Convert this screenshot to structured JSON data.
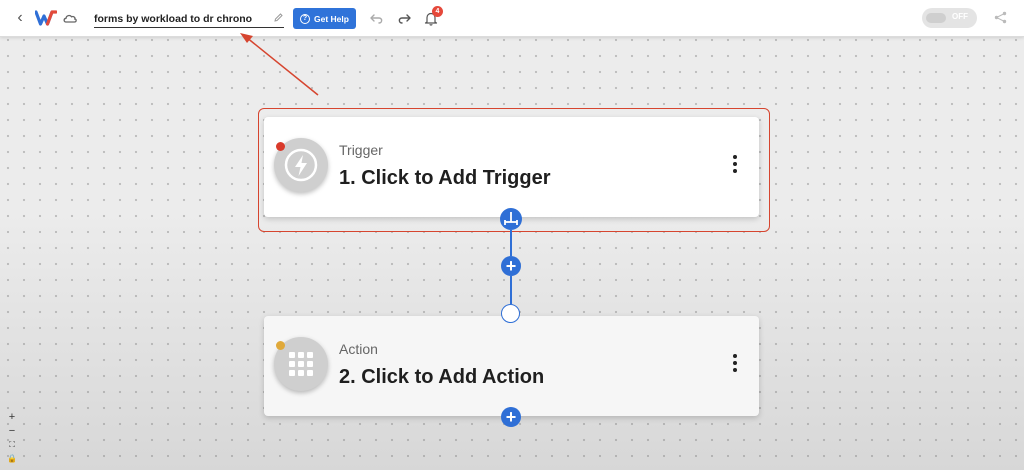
{
  "topbar": {
    "back_label": "‹",
    "logo_icon": "workload-logo-icon",
    "workflow_name": "forms by workload to dr chrono",
    "help_button_label": "Get Help",
    "help_icon_glyph": "?",
    "notification_count": "4",
    "toggle_label": "OFF"
  },
  "canvas": {
    "trigger": {
      "type_label": "Trigger",
      "title": "1. Click to Add Trigger",
      "status_color": "#d93a2b"
    },
    "action": {
      "type_label": "Action",
      "title": "2. Click to Add Action",
      "status_color": "#e0a93a"
    },
    "add_glyph": "+"
  },
  "zoom": {
    "zoom_in": "+",
    "zoom_out": "−",
    "fit": "⛶",
    "lock": "🔒"
  },
  "colors": {
    "accent": "#2f6fd6",
    "annotation": "#d6452f",
    "badge": "#e5483a"
  }
}
